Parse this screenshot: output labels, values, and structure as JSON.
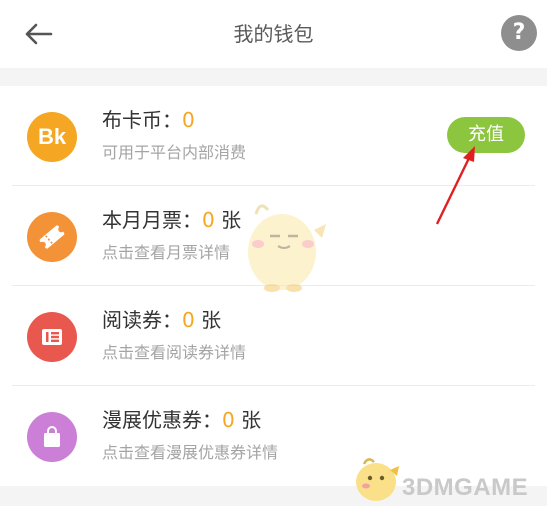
{
  "header": {
    "title": "我的钱包",
    "back_icon": "back-arrow-icon",
    "help_icon": "help-question-icon",
    "help_glyph": "?"
  },
  "wallet": {
    "items": [
      {
        "name": "布卡币：",
        "count": "0",
        "unit": "",
        "desc": "可用于平台内部消费",
        "icon": "coin-bk-icon",
        "icon_text": "Bk",
        "color": "#f5a623"
      },
      {
        "name": "本月月票：",
        "count": "0",
        "unit": " 张",
        "desc": "点击查看月票详情",
        "icon": "ticket-icon",
        "color": "#f39237"
      },
      {
        "name": "阅读券：",
        "count": "0",
        "unit": " 张",
        "desc": "点击查看阅读券详情",
        "icon": "reading-coupon-icon",
        "color": "#e9584f"
      },
      {
        "name": "漫展优惠券：",
        "count": "0",
        "unit": " 张",
        "desc": "点击查看漫展优惠券详情",
        "icon": "bag-icon",
        "color": "#cc7fd6"
      }
    ],
    "recharge_label": "充值"
  },
  "watermark": {
    "text": "3DMGAME"
  },
  "colors": {
    "accent": "#f5a623",
    "recharge": "#8cc63f",
    "annotation_arrow": "#e02020"
  }
}
